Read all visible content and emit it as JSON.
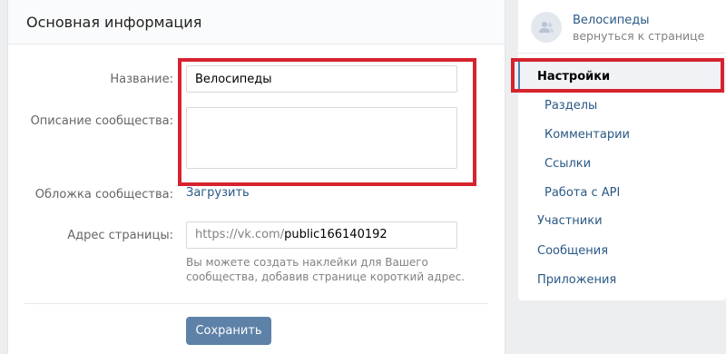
{
  "main": {
    "title": "Основная информация",
    "name_label": "Название:",
    "name_value": "Велосипеды",
    "description_label": "Описание сообщества:",
    "description_value": "",
    "cover_label": "Обложка сообщества:",
    "cover_upload": "Загрузить",
    "address_label": "Адрес страницы:",
    "address_prefix": "https://vk.com/",
    "address_value": "public166140192",
    "address_hint": "Вы можете создать наклейки для Вашего сообщества, добавив странице короткий адрес.",
    "save_label": "Сохранить"
  },
  "sidebar": {
    "group_name": "Велосипеды",
    "back_label": "вернуться к странице",
    "active_item": "Настройки",
    "sub_items": [
      "Разделы",
      "Комментарии",
      "Ссылки",
      "Работа с API"
    ],
    "items": [
      "Участники",
      "Сообщения",
      "Приложения"
    ]
  },
  "colors": {
    "highlight": "#d6232f",
    "link": "#2a5885",
    "button": "#5e81a8"
  }
}
